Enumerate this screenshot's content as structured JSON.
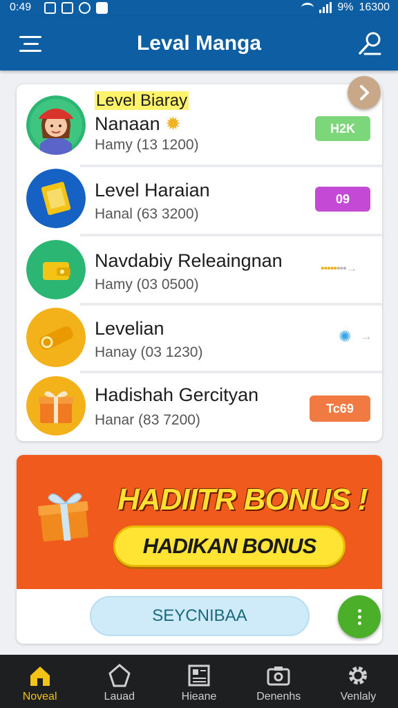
{
  "status_bar": {
    "time": "0:49",
    "battery": "9%",
    "clock": "16300"
  },
  "app_bar": {
    "title": "Leval Manga"
  },
  "list": {
    "items": [
      {
        "tag": "Level Biaray",
        "name": "Nanaan",
        "sub": "Hamy (13 1200)",
        "badge": "H2K",
        "badge_color": "#7cd67a"
      },
      {
        "name": "Level Haraian",
        "sub": "Hanal (63 3200)",
        "badge": "09",
        "badge_color": "#c44ad6"
      },
      {
        "name": "Navdabiy Releaingnan",
        "sub": "Hamy (03 0500)"
      },
      {
        "name": "Levelian",
        "sub": "Hanay (03 1230)"
      },
      {
        "name": "Hadishah Gercityan",
        "sub": "Hanar (83 7200)",
        "badge": "Tc69",
        "badge_color": "#f07a42"
      }
    ]
  },
  "bonus": {
    "title": "HADIITR BONUS !",
    "button": "HADIKAN BONUS",
    "secondary": "SEYCNIBAA"
  },
  "bottom_nav": {
    "items": [
      {
        "label": "Noveal",
        "icon": "home-icon"
      },
      {
        "label": "Lauad",
        "icon": "pentagon-icon"
      },
      {
        "label": "Hieane",
        "icon": "news-icon"
      },
      {
        "label": "Denenhs",
        "icon": "camera-icon"
      },
      {
        "label": "Venlaly",
        "icon": "gear-icon"
      }
    ]
  },
  "colors": {
    "primary": "#0d5ea3",
    "bonus": "#f15a1d",
    "accent": "#f3c316",
    "fab": "#4caf2a"
  }
}
